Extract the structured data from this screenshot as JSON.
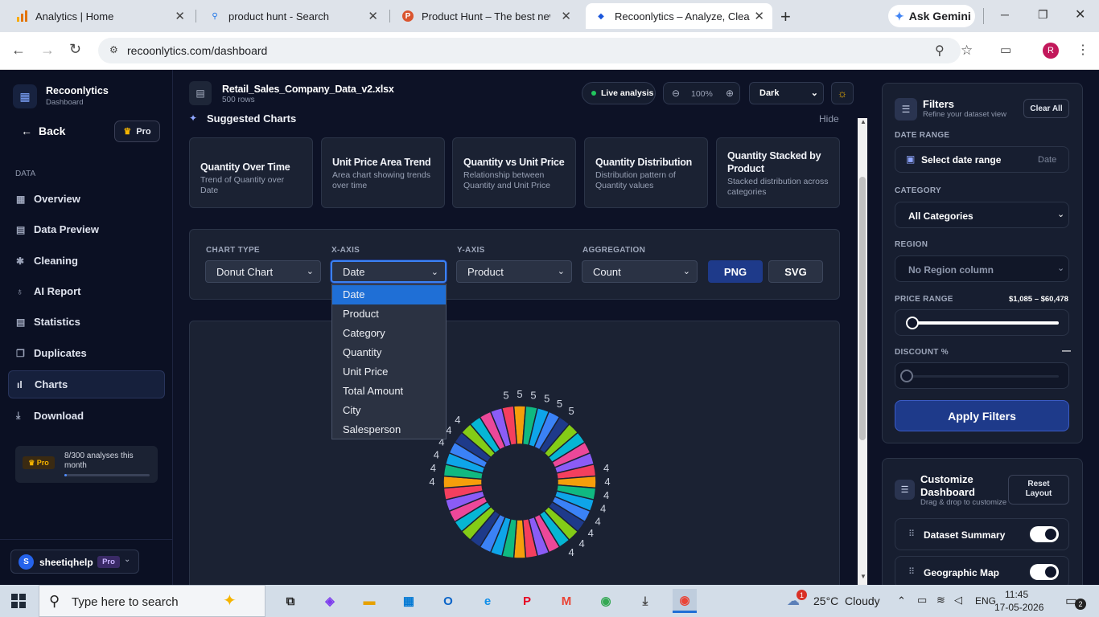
{
  "browser": {
    "tabs": [
      {
        "title": "Analytics | Home",
        "active": false
      },
      {
        "title": "product hunt - Search",
        "active": false
      },
      {
        "title": "Product Hunt – The best new p",
        "active": false
      },
      {
        "title": "Recoonlytics – Analyze, Clean &",
        "active": true
      }
    ],
    "new_tab": "+",
    "ask_gemini": "Ask Gemini",
    "url": "recoonlytics.com/dashboard",
    "profile_initial": "R"
  },
  "sidebar": {
    "app_name": "Recoonlytics",
    "app_sub": "Dashboard",
    "back_label": "Back",
    "pro_label": "Pro",
    "section_label": "DATA",
    "items": [
      {
        "label": "Overview",
        "icon": "grid-icon"
      },
      {
        "label": "Data Preview",
        "icon": "table-icon"
      },
      {
        "label": "Cleaning",
        "icon": "sparkle-icon"
      },
      {
        "label": "AI Report",
        "icon": "bulb-icon"
      },
      {
        "label": "Statistics",
        "icon": "doc-icon"
      },
      {
        "label": "Duplicates",
        "icon": "copy-icon"
      },
      {
        "label": "Charts",
        "icon": "bar-chart-icon",
        "active": true
      },
      {
        "label": "Download",
        "icon": "download-icon"
      }
    ],
    "usage_badge": "Pro",
    "usage_text": "8/300 analyses this month",
    "usage_fraction": 0.027,
    "user_initial": "S",
    "user_name": "sheetiqhelp",
    "user_badge": "Pro"
  },
  "header": {
    "file_name": "Retail_Sales_Company_Data_v2.xlsx",
    "rows": "500 rows",
    "live_label": "Live analysis",
    "zoom": "100%",
    "theme": "Dark"
  },
  "suggested": {
    "title": "Suggested Charts",
    "hide": "Hide",
    "cards": [
      {
        "title": "Quantity Over Time",
        "desc": "Trend of Quantity over Date"
      },
      {
        "title": "Unit Price Area Trend",
        "desc": "Area chart showing trends over time"
      },
      {
        "title": "Quantity vs Unit Price",
        "desc": "Relationship between Quantity and Unit Price"
      },
      {
        "title": "Quantity Distribution",
        "desc": "Distribution pattern of Quantity values"
      },
      {
        "title": "Quantity Stacked by Product",
        "desc": "Stacked distribution across categories"
      }
    ]
  },
  "controls": {
    "chart_type_label": "CHART TYPE",
    "chart_type": "Donut Chart",
    "x_label": "X-AXIS",
    "x_value": "Date",
    "y_label": "Y-AXIS",
    "y_value": "Product",
    "agg_label": "AGGREGATION",
    "agg_value": "Count",
    "png": "PNG",
    "svg": "SVG",
    "x_options": [
      "Date",
      "Product",
      "Category",
      "Quantity",
      "Unit Price",
      "Total Amount",
      "City",
      "Salesperson"
    ]
  },
  "chart_data": {
    "type": "pie",
    "donut": true,
    "visible_labels": [
      "5",
      "5",
      "5",
      "5",
      "5",
      "5",
      "4",
      "4",
      "4",
      "4",
      "4",
      "4",
      "4",
      "4",
      "4",
      "4",
      "4",
      "4",
      "4",
      "4"
    ],
    "colors": [
      "#f59e0b",
      "#10b981",
      "#0ea5e9",
      "#3b82f6",
      "#1e3a8a",
      "#84cc16",
      "#06b6d4",
      "#ec4899",
      "#8b5cf6",
      "#f43f5e",
      "#f59e0b",
      "#10b981",
      "#0ea5e9",
      "#3b82f6",
      "#1e3a8a",
      "#84cc16",
      "#06b6d4",
      "#ec4899",
      "#8b5cf6",
      "#f43f5e"
    ]
  },
  "filters": {
    "title": "Filters",
    "sub": "Refine your dataset view",
    "clear": "Clear All",
    "date_label": "DATE RANGE",
    "date_placeholder": "Select date range",
    "date_tag": "Date",
    "category_label": "CATEGORY",
    "category_value": "All Categories",
    "region_label": "REGION",
    "region_value": "No Region column",
    "price_label": "PRICE RANGE",
    "price_value": "$1,085 – $60,478",
    "discount_label": "DISCOUNT %",
    "discount_value": "—",
    "apply": "Apply Filters"
  },
  "customize": {
    "title": "Customize Dashboard",
    "sub": "Drag & drop to customize",
    "reset": "Reset Layout",
    "items": [
      {
        "label": "Dataset Summary",
        "on": true
      },
      {
        "label": "Geographic Map",
        "on": true
      }
    ]
  },
  "taskbar": {
    "search_placeholder": "Type here to search",
    "weather": "25°C  Cloudy",
    "lang": "ENG",
    "time": "11:45",
    "date": "17-05-2026",
    "notif_count": "2",
    "weather_badge": "1"
  }
}
